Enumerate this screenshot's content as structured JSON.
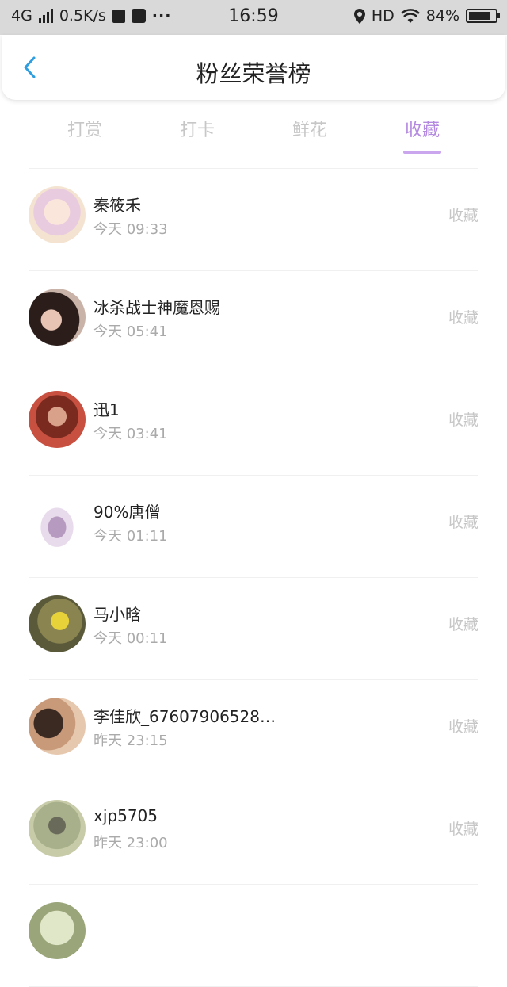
{
  "statusbar": {
    "network": "4G",
    "speed": "0.5K/s",
    "dots": "···",
    "time": "16:59",
    "hd": "HD",
    "battery": "84%",
    "battery_level": 0.84
  },
  "header": {
    "title": "粉丝荣誉榜"
  },
  "tabs": [
    {
      "label": "打赏"
    },
    {
      "label": "打卡"
    },
    {
      "label": "鲜花"
    },
    {
      "label": "收藏"
    }
  ],
  "list": [
    {
      "name": "秦筱禾",
      "time": "今天 09:33",
      "action": "收藏"
    },
    {
      "name": "冰杀战士神魔恩赐",
      "time": "今天 05:41",
      "action": "收藏"
    },
    {
      "name": "迅1",
      "time": "今天 03:41",
      "action": "收藏"
    },
    {
      "name": "90%唐僧",
      "time": "今天 01:11",
      "action": "收藏"
    },
    {
      "name": "马小晗",
      "time": "今天 00:11",
      "action": "收藏"
    },
    {
      "name": "李佳欣_67607906528…",
      "time": "昨天 23:15",
      "action": "收藏"
    },
    {
      "name": "xjp5705",
      "time": "昨天 23:00",
      "action": "收藏"
    }
  ]
}
